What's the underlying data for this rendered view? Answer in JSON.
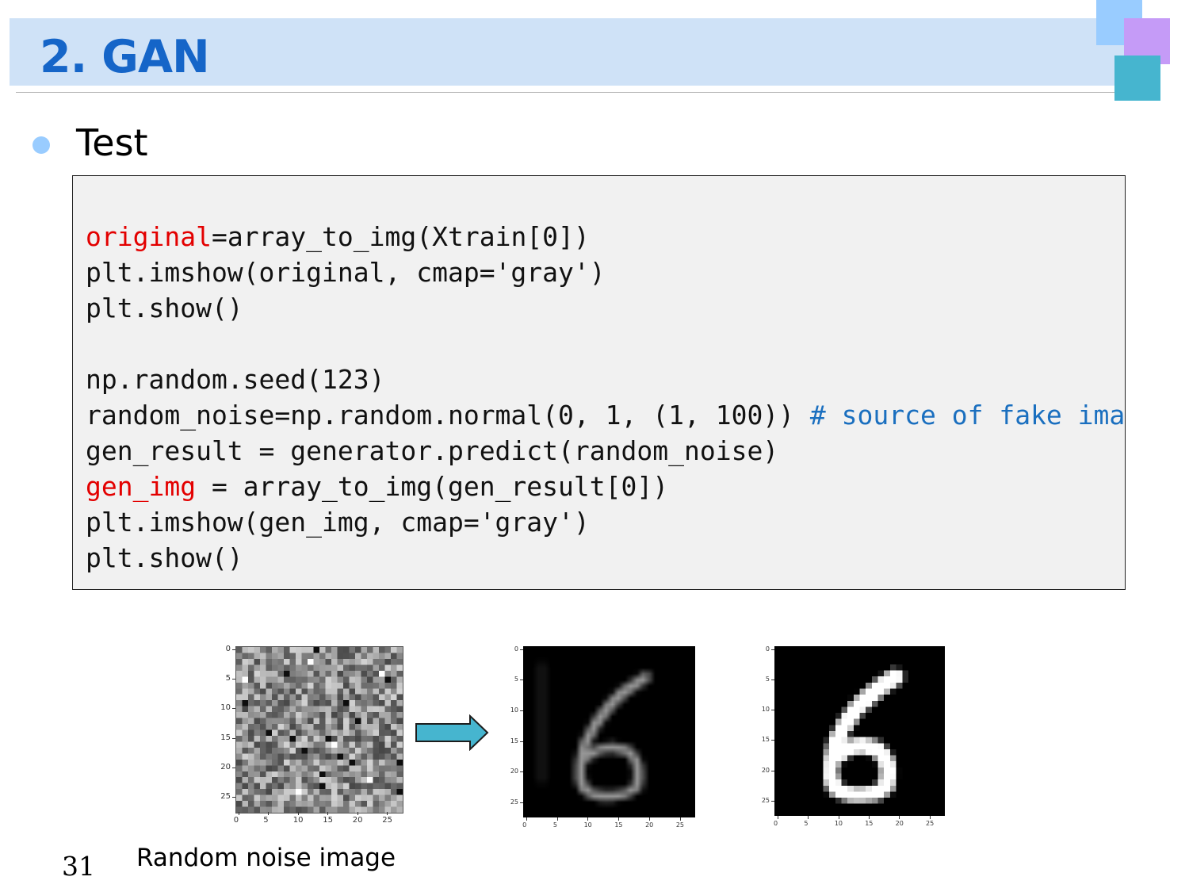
{
  "slide": {
    "title": "2. GAN",
    "bullet": "Test",
    "page_number": "31",
    "caption": "Random noise image"
  },
  "code": {
    "lines": [
      {
        "segments": [
          {
            "text": "original",
            "style": "red"
          },
          {
            "text": "=array_to_img(Xtrain[0])",
            "style": "plain"
          }
        ]
      },
      {
        "segments": [
          {
            "text": "plt.imshow(original, cmap='gray')",
            "style": "plain"
          }
        ]
      },
      {
        "segments": [
          {
            "text": "plt.show()",
            "style": "plain"
          }
        ]
      },
      {
        "segments": []
      },
      {
        "segments": [
          {
            "text": "np.random.seed(123)",
            "style": "plain"
          }
        ]
      },
      {
        "segments": [
          {
            "text": "random_noise=np.random.normal(0, 1, (1, 100)) ",
            "style": "plain"
          },
          {
            "text": "# source of fake image",
            "style": "comment"
          }
        ]
      },
      {
        "segments": [
          {
            "text": "gen_result = generator.predict(random_noise)",
            "style": "plain"
          }
        ]
      },
      {
        "segments": [
          {
            "text": "gen_img",
            "style": "red"
          },
          {
            "text": " = array_to_img(gen_result[0])",
            "style": "plain"
          }
        ]
      },
      {
        "segments": [
          {
            "text": "plt.imshow(gen_img, cmap='gray')",
            "style": "plain"
          }
        ]
      },
      {
        "segments": [
          {
            "text": "plt.show()",
            "style": "plain"
          }
        ]
      }
    ]
  },
  "plots": [
    {
      "name": "noise-plot",
      "content": "random noise",
      "yticks": [
        "0",
        "5",
        "10",
        "15",
        "20",
        "25"
      ],
      "xticks": [
        "0",
        "5",
        "10",
        "15",
        "20",
        "25"
      ]
    },
    {
      "name": "generated-plot",
      "content": "generated digit 6",
      "yticks": [
        "0",
        "5",
        "10",
        "15",
        "20",
        "25"
      ],
      "xticks": [
        "0",
        "5",
        "10",
        "15",
        "20",
        "25"
      ]
    },
    {
      "name": "original-plot",
      "content": "original digit 6",
      "yticks": [
        "0",
        "5",
        "10",
        "15",
        "20",
        "25"
      ],
      "xticks": [
        "0",
        "5",
        "10",
        "15",
        "20",
        "25"
      ]
    }
  ],
  "colors": {
    "title": "#1565c8",
    "header_band": "#cfe2f7",
    "code_highlight": "#e30000",
    "code_comment": "#1a6fbf",
    "arrow": "#46b5cf"
  },
  "icons": [
    "right-arrow-icon",
    "bullet-dot-icon"
  ]
}
